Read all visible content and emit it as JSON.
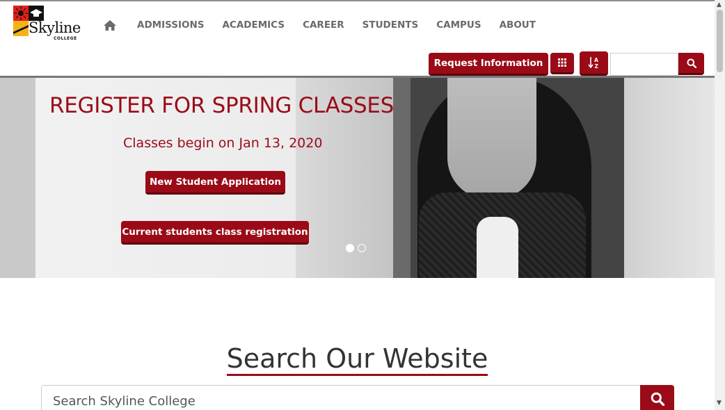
{
  "header": {
    "logo": {
      "name": "Skyline",
      "sub": "COLLEGE",
      "colors": [
        "#e2201b",
        "#111111",
        "#f5b21b"
      ]
    },
    "nav": {
      "home_icon": "home-icon",
      "items": [
        "ADMISSIONS",
        "ACADEMICS",
        "CAREER",
        "STUDENTS",
        "CAMPUS",
        "ABOUT"
      ]
    },
    "actions": {
      "request_info": "Request Information",
      "grid_icon": "grid-icon",
      "az_icon": "sort-az-icon",
      "search_placeholder": "",
      "search_icon": "search-icon"
    }
  },
  "hero": {
    "title": "REGISTER FOR SPRING CLASSES",
    "subtitle": "Classes begin on Jan 13, 2020",
    "cta_new": "New Student Application",
    "cta_current": "Current students class registration",
    "slides": {
      "count": 2,
      "active": 1
    }
  },
  "search_section": {
    "title": "Search Our Website",
    "placeholder": "Search Skyline College",
    "button_icon": "search-icon"
  },
  "colors": {
    "accent": "#9a0b17",
    "nav_text": "#6a6a6a"
  }
}
